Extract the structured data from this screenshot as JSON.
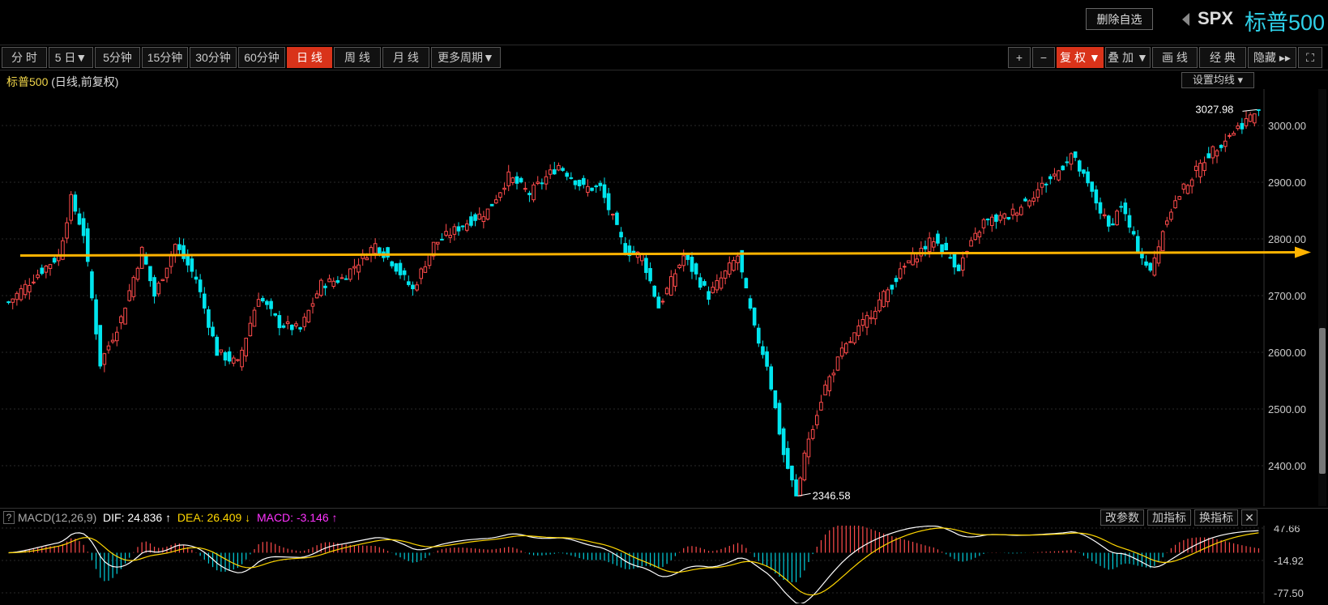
{
  "header": {
    "delete_watch_label": "删除自选",
    "symbol_code": "SPX",
    "symbol_name": "标普500"
  },
  "periods": [
    {
      "label": "分 时",
      "active": false
    },
    {
      "label": "5 日▼",
      "active": false
    },
    {
      "label": "5分钟",
      "active": false
    },
    {
      "label": "15分钟",
      "active": false
    },
    {
      "label": "30分钟",
      "active": false
    },
    {
      "label": "60分钟",
      "active": false
    },
    {
      "label": "日 线",
      "active": true
    },
    {
      "label": "周 线",
      "active": false
    },
    {
      "label": "月 线",
      "active": false
    },
    {
      "label": "更多周期▼",
      "active": false
    }
  ],
  "tools": [
    {
      "label": "+",
      "active": false
    },
    {
      "label": "−",
      "active": false
    },
    {
      "label": "复 权 ▼",
      "active": true
    },
    {
      "label": "叠 加 ▼",
      "active": false
    },
    {
      "label": "画 线",
      "active": false
    },
    {
      "label": "经 典",
      "active": false
    },
    {
      "label": "隐藏 ▸▸",
      "active": false
    },
    {
      "label": "⛶",
      "active": false
    }
  ],
  "chart_title": {
    "name": "标普500",
    "mode": " (日线,前复权)"
  },
  "ma_settings_label": "设置均线 ▾",
  "chart_data": {
    "type": "candlestick",
    "y_ticks": [
      "3000.00",
      "2900.00",
      "2800.00",
      "2700.00",
      "2600.00",
      "2500.00",
      "2400.00"
    ],
    "y_tick_values": [
      3000,
      2900,
      2800,
      2700,
      2600,
      2500,
      2400
    ],
    "high_label": "3027.98",
    "low_label": "2346.58",
    "high_value": 3027.98,
    "low_value": 2346.58,
    "horizontal_line_level": 2775,
    "up_color": "#ff4b4b",
    "down_color": "#00e5ee",
    "line_color": "#ffb300",
    "close_anchors": [
      [
        0,
        2688
      ],
      [
        8,
        2745
      ],
      [
        12,
        2770
      ],
      [
        15,
        2870
      ],
      [
        18,
        2810
      ],
      [
        22,
        2580
      ],
      [
        27,
        2660
      ],
      [
        32,
        2780
      ],
      [
        35,
        2700
      ],
      [
        40,
        2790
      ],
      [
        45,
        2730
      ],
      [
        50,
        2600
      ],
      [
        55,
        2580
      ],
      [
        60,
        2700
      ],
      [
        65,
        2650
      ],
      [
        70,
        2640
      ],
      [
        75,
        2720
      ],
      [
        80,
        2730
      ],
      [
        88,
        2790
      ],
      [
        92,
        2760
      ],
      [
        97,
        2710
      ],
      [
        102,
        2790
      ],
      [
        108,
        2820
      ],
      [
        115,
        2850
      ],
      [
        120,
        2910
      ],
      [
        125,
        2880
      ],
      [
        132,
        2930
      ],
      [
        138,
        2890
      ],
      [
        142,
        2890
      ],
      [
        148,
        2780
      ],
      [
        152,
        2770
      ],
      [
        156,
        2680
      ],
      [
        162,
        2770
      ],
      [
        168,
        2700
      ],
      [
        175,
        2770
      ],
      [
        179,
        2640
      ],
      [
        182,
        2580
      ],
      [
        186,
        2420
      ],
      [
        189,
        2346.58
      ],
      [
        192,
        2450
      ],
      [
        196,
        2540
      ],
      [
        200,
        2600
      ],
      [
        205,
        2650
      ],
      [
        210,
        2700
      ],
      [
        216,
        2760
      ],
      [
        222,
        2800
      ],
      [
        228,
        2750
      ],
      [
        234,
        2830
      ],
      [
        240,
        2840
      ],
      [
        246,
        2880
      ],
      [
        252,
        2920
      ],
      [
        255,
        2950
      ],
      [
        260,
        2880
      ],
      [
        264,
        2820
      ],
      [
        267,
        2860
      ],
      [
        270,
        2800
      ],
      [
        274,
        2740
      ],
      [
        278,
        2840
      ],
      [
        282,
        2890
      ],
      [
        288,
        2950
      ],
      [
        294,
        2990
      ],
      [
        300,
        3027.98
      ]
    ]
  },
  "macd": {
    "name": "MACD(12,26,9)",
    "dif_label": "DIF: 24.836 ↑",
    "dea_label": "DEA: 26.409 ↓",
    "macd_label": "MACD: -3.146 ↑",
    "dif_color": "#ffffff",
    "dea_color": "#ffd700",
    "macd_color": "#ff33ff",
    "y_ticks": [
      "47.66",
      "-14.92",
      "-77.50"
    ],
    "buttons": [
      "改参数",
      "加指标",
      "换指标",
      "✕"
    ]
  }
}
